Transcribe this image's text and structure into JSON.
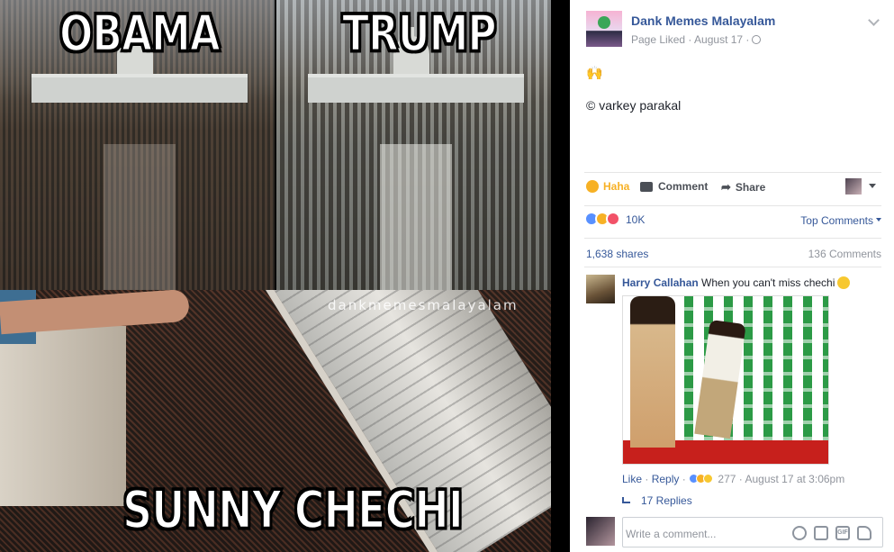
{
  "meme": {
    "caption_top_left": "OBAMA",
    "caption_top_right": "TRUMP",
    "caption_bottom": "SUNNY CHECHI",
    "watermark": "dankmemesmalayalam"
  },
  "post": {
    "page_name": "Dank Memes Malayalam",
    "meta": "Page Liked · August 17 ·",
    "emoji_line": "🙌",
    "body_text": "© varkey parakal",
    "actions": {
      "reaction_label": "Haha",
      "comment_label": "Comment",
      "share_label": "Share"
    },
    "reactions_count": "10K",
    "top_comments_label": "Top Comments",
    "shares": "1,638 shares",
    "comments_count": "136 Comments"
  },
  "comment": {
    "author": "Harry Callahan",
    "text": "When you can't miss chechi",
    "like_label": "Like",
    "reply_label": "Reply",
    "reaction_count": "277",
    "timestamp": "August 17 at 3:06pm",
    "replies_label": "17 Replies"
  },
  "composer": {
    "placeholder": "Write a comment..."
  },
  "colors": {
    "link": "#365899",
    "haha": "#f7b125",
    "muted": "#90949c"
  }
}
